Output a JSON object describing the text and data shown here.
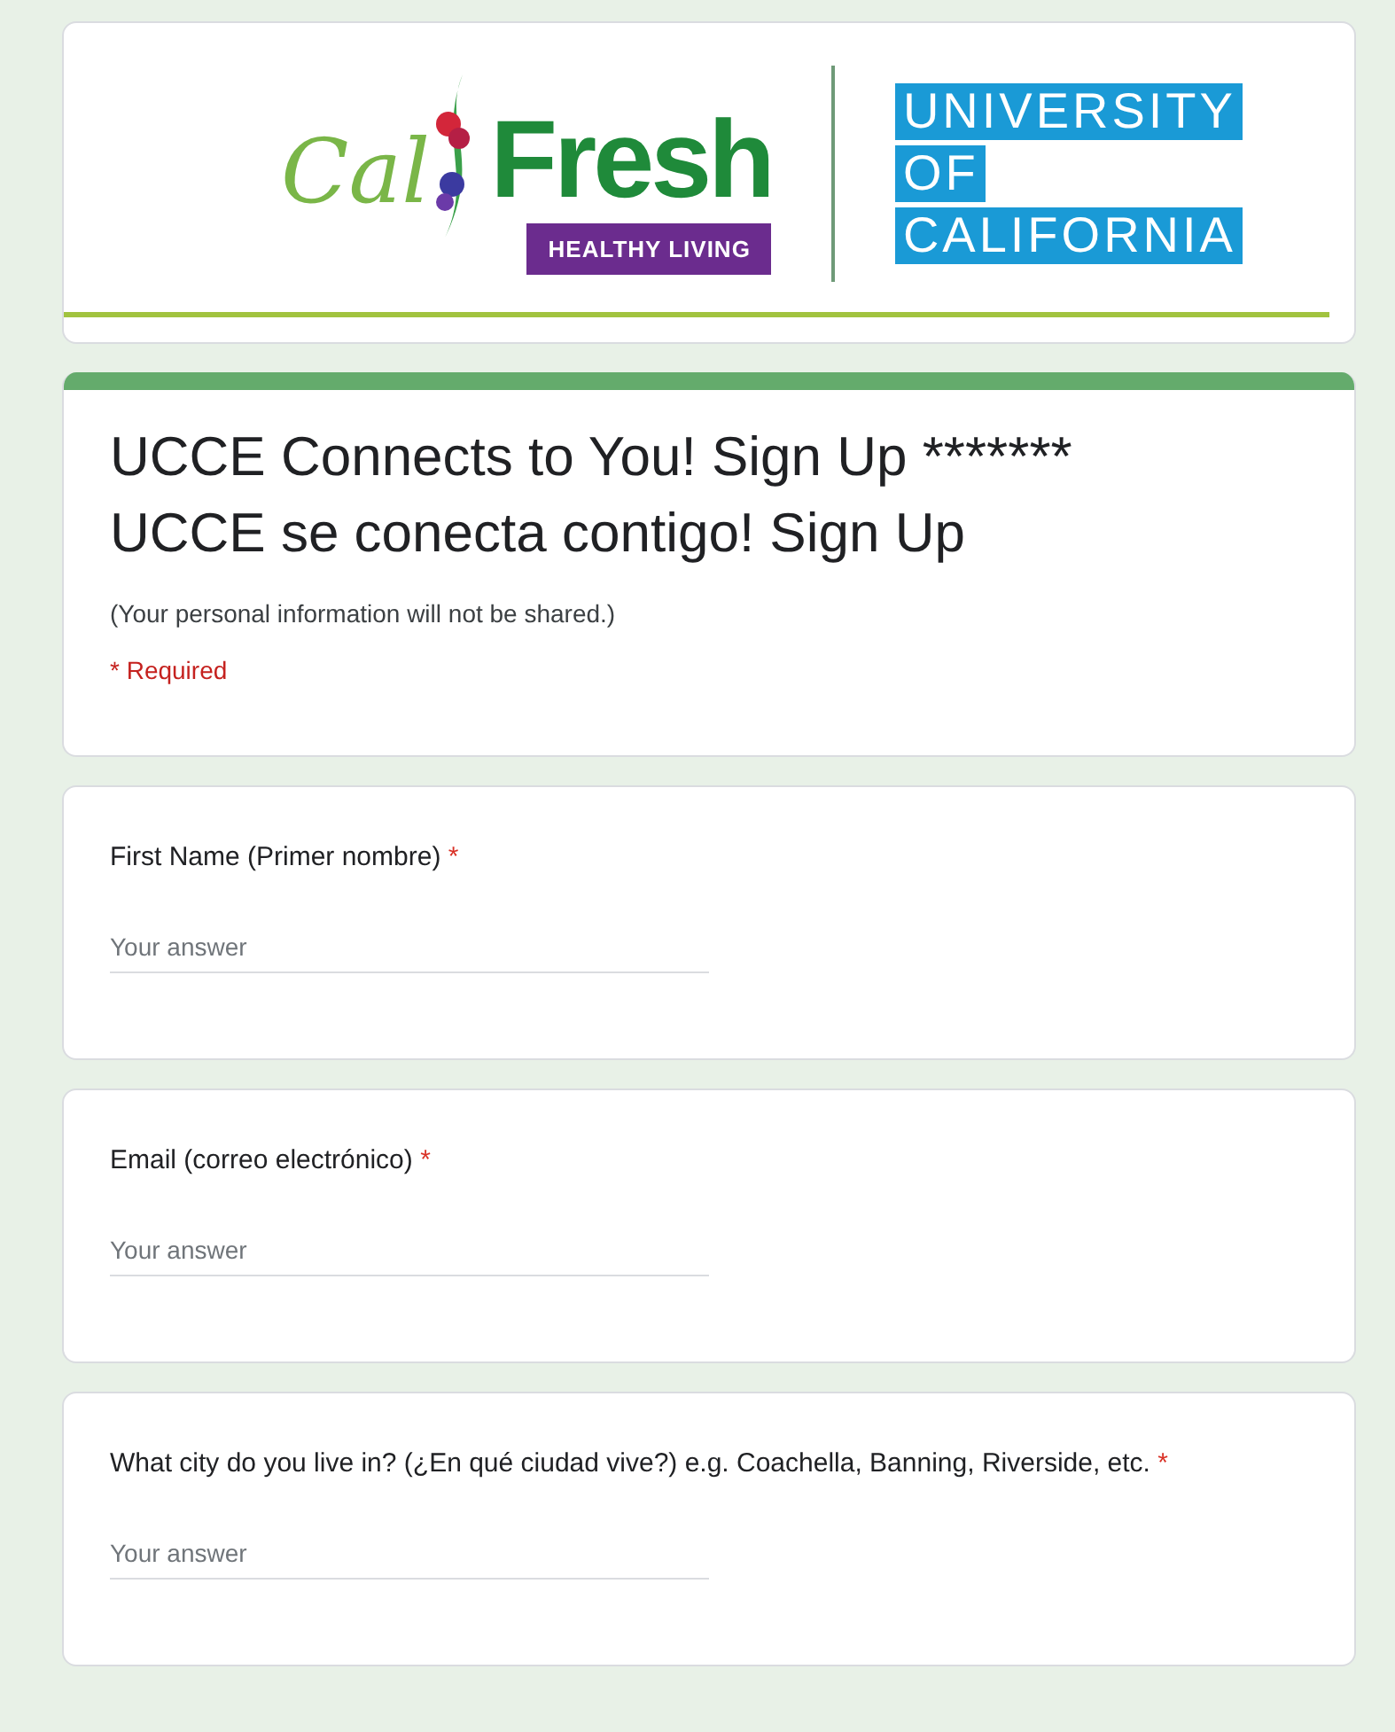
{
  "header": {
    "calfresh": {
      "script": "Cal",
      "wordmark": "Fresh",
      "tagline": "HEALTHY LIVING"
    },
    "university": [
      "UNIVERSITY",
      "OF",
      "CALIFORNIA"
    ]
  },
  "form": {
    "title_lines": [
      "UCCE Connects to You! Sign Up *******",
      "UCCE se conecta contigo! Sign Up"
    ],
    "description": "(Your personal information will not be shared.)",
    "required_note": "* Required"
  },
  "questions": [
    {
      "label": "First Name (Primer nombre)",
      "required_mark": "*",
      "placeholder": "Your answer"
    },
    {
      "label": "Email (correo electrónico)",
      "required_mark": "*",
      "placeholder": "Your answer"
    },
    {
      "label": "What city do you live in? (¿En qué ciudad vive?) e.g. Coachella, Banning, Riverside, etc.",
      "required_mark": "*",
      "placeholder": "Your answer"
    }
  ]
}
